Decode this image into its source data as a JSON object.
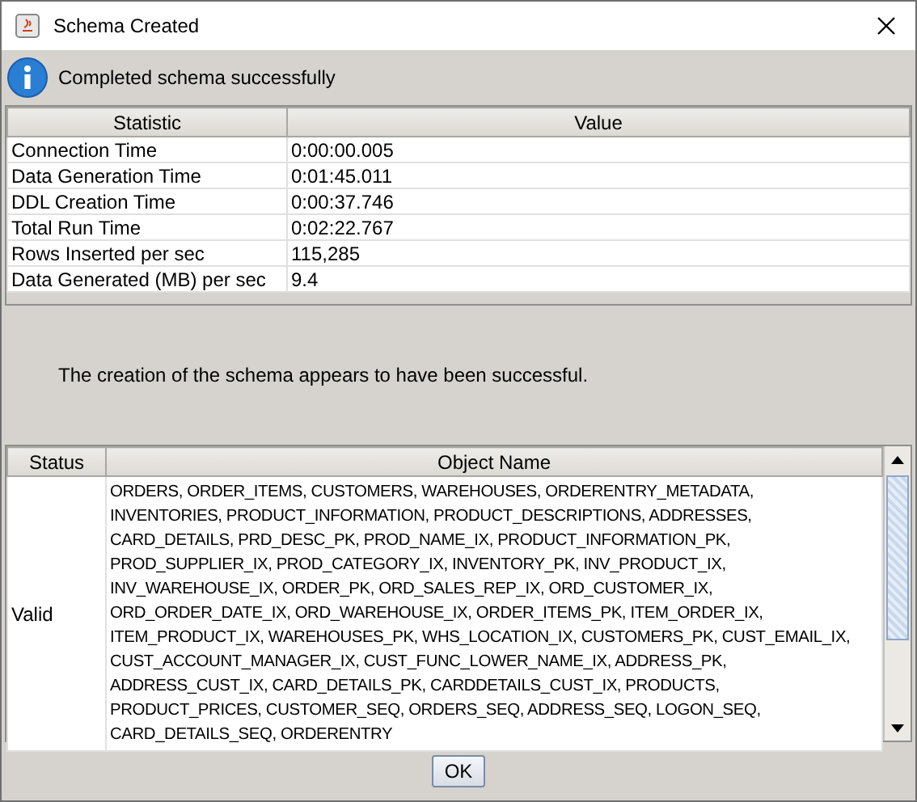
{
  "window": {
    "title": "Schema Created"
  },
  "message": "Completed schema successfully",
  "statistics": {
    "columns": [
      "Statistic",
      "Value"
    ],
    "rows": [
      {
        "statistic": "Connection Time",
        "value": "0:00:00.005"
      },
      {
        "statistic": "Data Generation Time",
        "value": "0:01:45.011"
      },
      {
        "statistic": "DDL Creation Time",
        "value": "0:00:37.746"
      },
      {
        "statistic": "Total Run Time",
        "value": "0:02:22.767"
      },
      {
        "statistic": "Rows Inserted per sec",
        "value": "115,285"
      },
      {
        "statistic": "Data Generated (MB) per sec",
        "value": "9.4"
      }
    ]
  },
  "result_text": "The creation of the schema appears to have been successful.",
  "objects": {
    "columns": [
      "Status",
      "Object Name"
    ],
    "rows": [
      {
        "status": "Valid",
        "object_name_lines": [
          "ORDERS, ORDER_ITEMS, CUSTOMERS, WAREHOUSES, ORDERENTRY_METADATA,",
          "INVENTORIES, PRODUCT_INFORMATION, PRODUCT_DESCRIPTIONS, ADDRESSES,",
          "CARD_DETAILS, PRD_DESC_PK, PROD_NAME_IX, PRODUCT_INFORMATION_PK,",
          "PROD_SUPPLIER_IX, PROD_CATEGORY_IX, INVENTORY_PK, INV_PRODUCT_IX,",
          "INV_WAREHOUSE_IX, ORDER_PK, ORD_SALES_REP_IX, ORD_CUSTOMER_IX,",
          "ORD_ORDER_DATE_IX, ORD_WAREHOUSE_IX, ORDER_ITEMS_PK, ITEM_ORDER_IX,",
          "ITEM_PRODUCT_IX, WAREHOUSES_PK, WHS_LOCATION_IX, CUSTOMERS_PK, CUST_EMAIL_IX,",
          "CUST_ACCOUNT_MANAGER_IX, CUST_FUNC_LOWER_NAME_IX, ADDRESS_PK,",
          "ADDRESS_CUST_IX, CARD_DETAILS_PK, CARDDETAILS_CUST_IX, PRODUCTS,",
          "PRODUCT_PRICES, CUSTOMER_SEQ, ORDERS_SEQ, ADDRESS_SEQ, LOGON_SEQ,",
          "CARD_DETAILS_SEQ, ORDERENTRY"
        ]
      }
    ]
  },
  "buttons": [
    "OK"
  ]
}
